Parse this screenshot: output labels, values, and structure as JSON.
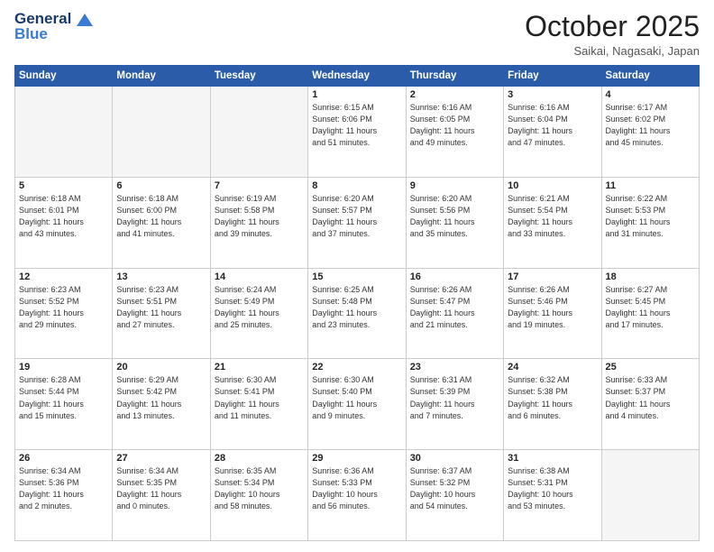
{
  "header": {
    "logo_general": "General",
    "logo_blue": "Blue",
    "month": "October 2025",
    "location": "Saikai, Nagasaki, Japan"
  },
  "weekdays": [
    "Sunday",
    "Monday",
    "Tuesday",
    "Wednesday",
    "Thursday",
    "Friday",
    "Saturday"
  ],
  "weeks": [
    [
      {
        "day": "",
        "info": ""
      },
      {
        "day": "",
        "info": ""
      },
      {
        "day": "",
        "info": ""
      },
      {
        "day": "1",
        "info": "Sunrise: 6:15 AM\nSunset: 6:06 PM\nDaylight: 11 hours\nand 51 minutes."
      },
      {
        "day": "2",
        "info": "Sunrise: 6:16 AM\nSunset: 6:05 PM\nDaylight: 11 hours\nand 49 minutes."
      },
      {
        "day": "3",
        "info": "Sunrise: 6:16 AM\nSunset: 6:04 PM\nDaylight: 11 hours\nand 47 minutes."
      },
      {
        "day": "4",
        "info": "Sunrise: 6:17 AM\nSunset: 6:02 PM\nDaylight: 11 hours\nand 45 minutes."
      }
    ],
    [
      {
        "day": "5",
        "info": "Sunrise: 6:18 AM\nSunset: 6:01 PM\nDaylight: 11 hours\nand 43 minutes."
      },
      {
        "day": "6",
        "info": "Sunrise: 6:18 AM\nSunset: 6:00 PM\nDaylight: 11 hours\nand 41 minutes."
      },
      {
        "day": "7",
        "info": "Sunrise: 6:19 AM\nSunset: 5:58 PM\nDaylight: 11 hours\nand 39 minutes."
      },
      {
        "day": "8",
        "info": "Sunrise: 6:20 AM\nSunset: 5:57 PM\nDaylight: 11 hours\nand 37 minutes."
      },
      {
        "day": "9",
        "info": "Sunrise: 6:20 AM\nSunset: 5:56 PM\nDaylight: 11 hours\nand 35 minutes."
      },
      {
        "day": "10",
        "info": "Sunrise: 6:21 AM\nSunset: 5:54 PM\nDaylight: 11 hours\nand 33 minutes."
      },
      {
        "day": "11",
        "info": "Sunrise: 6:22 AM\nSunset: 5:53 PM\nDaylight: 11 hours\nand 31 minutes."
      }
    ],
    [
      {
        "day": "12",
        "info": "Sunrise: 6:23 AM\nSunset: 5:52 PM\nDaylight: 11 hours\nand 29 minutes."
      },
      {
        "day": "13",
        "info": "Sunrise: 6:23 AM\nSunset: 5:51 PM\nDaylight: 11 hours\nand 27 minutes."
      },
      {
        "day": "14",
        "info": "Sunrise: 6:24 AM\nSunset: 5:49 PM\nDaylight: 11 hours\nand 25 minutes."
      },
      {
        "day": "15",
        "info": "Sunrise: 6:25 AM\nSunset: 5:48 PM\nDaylight: 11 hours\nand 23 minutes."
      },
      {
        "day": "16",
        "info": "Sunrise: 6:26 AM\nSunset: 5:47 PM\nDaylight: 11 hours\nand 21 minutes."
      },
      {
        "day": "17",
        "info": "Sunrise: 6:26 AM\nSunset: 5:46 PM\nDaylight: 11 hours\nand 19 minutes."
      },
      {
        "day": "18",
        "info": "Sunrise: 6:27 AM\nSunset: 5:45 PM\nDaylight: 11 hours\nand 17 minutes."
      }
    ],
    [
      {
        "day": "19",
        "info": "Sunrise: 6:28 AM\nSunset: 5:44 PM\nDaylight: 11 hours\nand 15 minutes."
      },
      {
        "day": "20",
        "info": "Sunrise: 6:29 AM\nSunset: 5:42 PM\nDaylight: 11 hours\nand 13 minutes."
      },
      {
        "day": "21",
        "info": "Sunrise: 6:30 AM\nSunset: 5:41 PM\nDaylight: 11 hours\nand 11 minutes."
      },
      {
        "day": "22",
        "info": "Sunrise: 6:30 AM\nSunset: 5:40 PM\nDaylight: 11 hours\nand 9 minutes."
      },
      {
        "day": "23",
        "info": "Sunrise: 6:31 AM\nSunset: 5:39 PM\nDaylight: 11 hours\nand 7 minutes."
      },
      {
        "day": "24",
        "info": "Sunrise: 6:32 AM\nSunset: 5:38 PM\nDaylight: 11 hours\nand 6 minutes."
      },
      {
        "day": "25",
        "info": "Sunrise: 6:33 AM\nSunset: 5:37 PM\nDaylight: 11 hours\nand 4 minutes."
      }
    ],
    [
      {
        "day": "26",
        "info": "Sunrise: 6:34 AM\nSunset: 5:36 PM\nDaylight: 11 hours\nand 2 minutes."
      },
      {
        "day": "27",
        "info": "Sunrise: 6:34 AM\nSunset: 5:35 PM\nDaylight: 11 hours\nand 0 minutes."
      },
      {
        "day": "28",
        "info": "Sunrise: 6:35 AM\nSunset: 5:34 PM\nDaylight: 10 hours\nand 58 minutes."
      },
      {
        "day": "29",
        "info": "Sunrise: 6:36 AM\nSunset: 5:33 PM\nDaylight: 10 hours\nand 56 minutes."
      },
      {
        "day": "30",
        "info": "Sunrise: 6:37 AM\nSunset: 5:32 PM\nDaylight: 10 hours\nand 54 minutes."
      },
      {
        "day": "31",
        "info": "Sunrise: 6:38 AM\nSunset: 5:31 PM\nDaylight: 10 hours\nand 53 minutes."
      },
      {
        "day": "",
        "info": ""
      }
    ]
  ]
}
